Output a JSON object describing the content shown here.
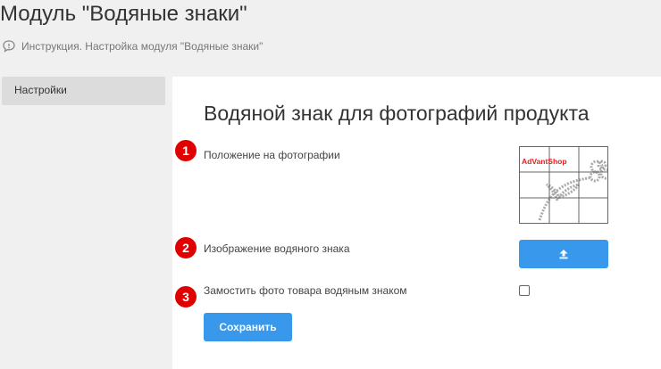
{
  "page": {
    "title": "Модуль \"Водяные знаки\"",
    "instruction_link": "Инструкция. Настройка модуля \"Водяные знаки\"",
    "instruction_icon": "speech-bubble-icon"
  },
  "sidebar": {
    "items": [
      {
        "label": "Настройки"
      }
    ]
  },
  "main": {
    "heading": "Водяной знак для фотографий продукта",
    "fields": [
      {
        "badge": "1",
        "label": "Положение на фотографии"
      },
      {
        "badge": "2",
        "label": "Изображение водяного знака"
      },
      {
        "badge": "3",
        "label": "Замостить фото товара водяным знаком",
        "checked": false
      }
    ],
    "watermark_text": "AdVantShop",
    "upload_icon": "upload-icon",
    "save_label": "Сохранить"
  },
  "colors": {
    "accent": "#3898ec",
    "badge": "#e00000",
    "watermark_text": "#e02020"
  }
}
